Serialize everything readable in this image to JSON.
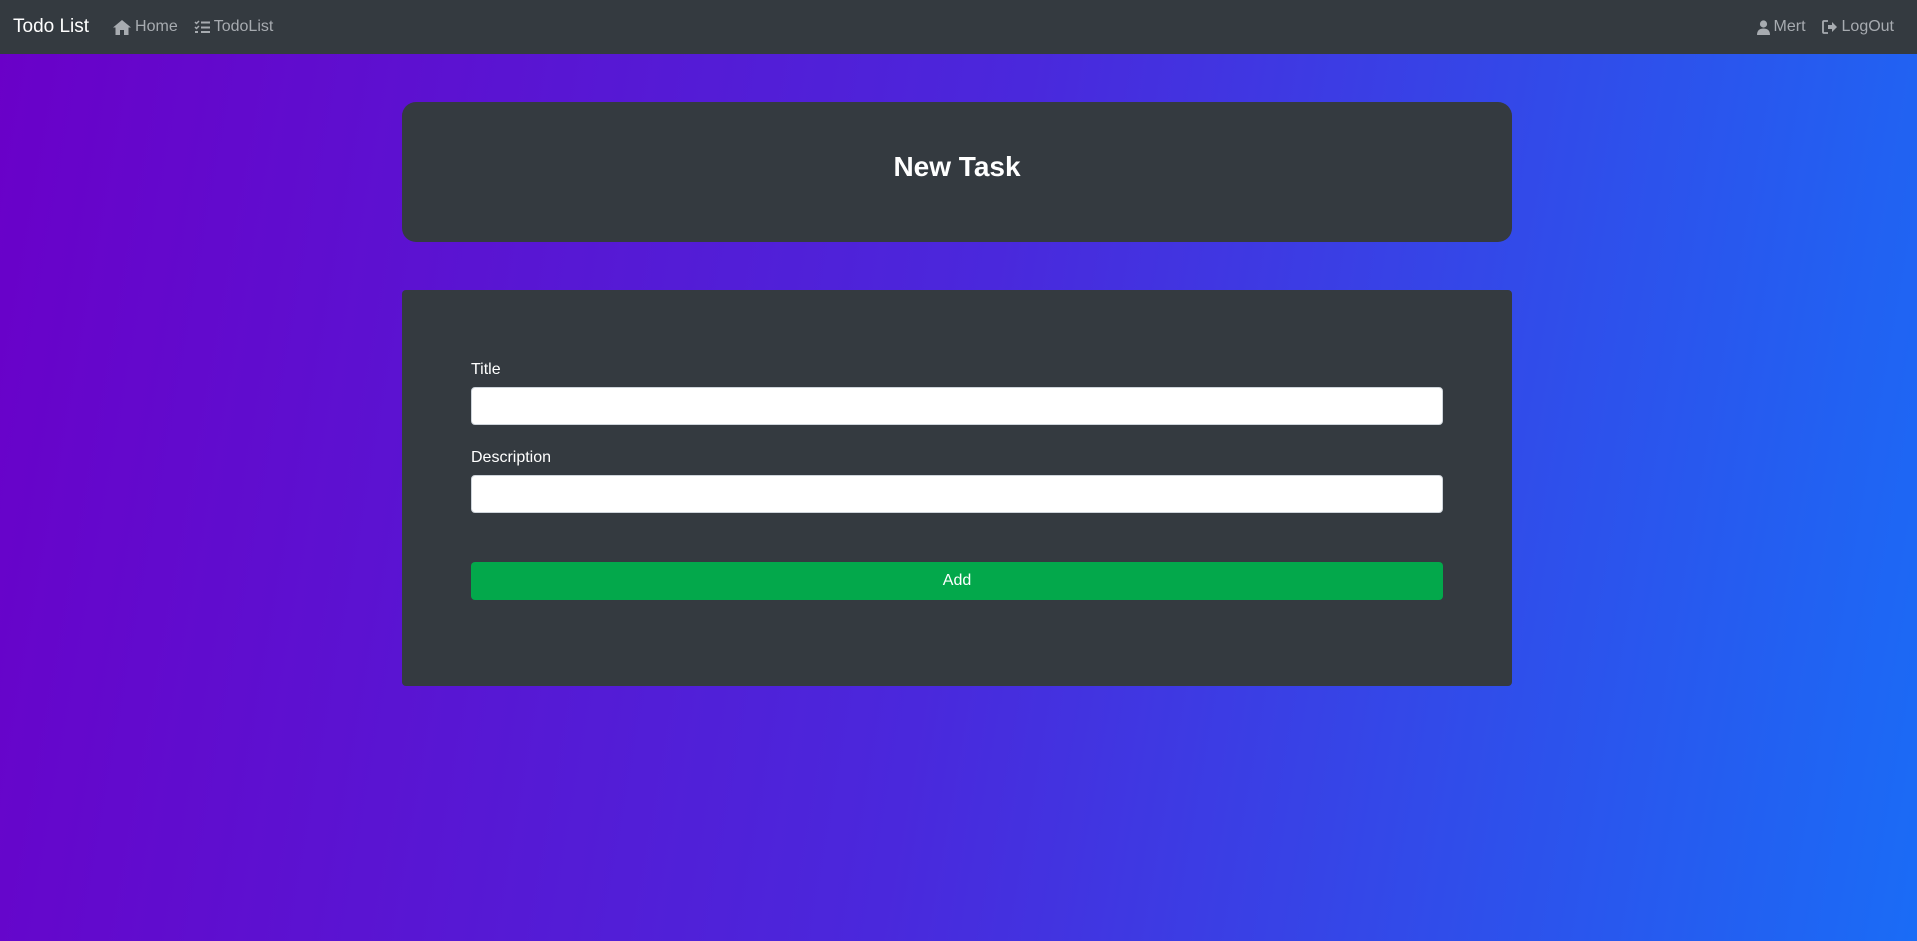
{
  "navbar": {
    "brand": "Todo List",
    "links": [
      {
        "label": "Home",
        "icon": "home-icon"
      },
      {
        "label": "TodoList",
        "icon": "list-check-icon"
      }
    ],
    "user": {
      "label": "Mert",
      "icon": "user-icon"
    },
    "logout": {
      "label": "LogOut",
      "icon": "logout-icon"
    }
  },
  "header": {
    "title": "New Task"
  },
  "form": {
    "title_label": "Title",
    "title_value": "",
    "description_label": "Description",
    "description_value": "",
    "submit_label": "Add"
  },
  "colors": {
    "navbar_bg": "#343a40",
    "card_bg": "#343a40",
    "gradient_start": "#6a00c8",
    "gradient_end": "#1a6cf6",
    "submit_bg": "#03a84b",
    "nav_link": "#a7abb0"
  }
}
